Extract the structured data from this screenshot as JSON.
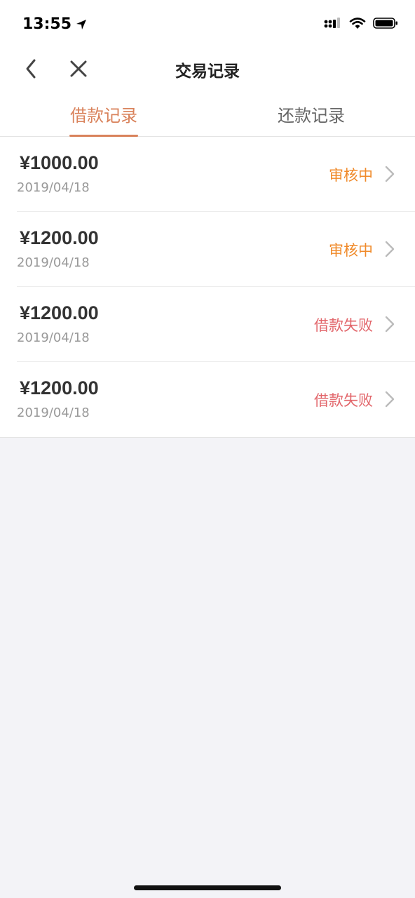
{
  "status_bar": {
    "time": "13:55",
    "icons": [
      "location-arrow-icon",
      "signal-icon",
      "wifi-icon",
      "battery-icon"
    ]
  },
  "nav": {
    "title": "交易记录",
    "back_icon": "chevron-left-icon",
    "close_icon": "close-icon"
  },
  "tabs": [
    {
      "label": "借款记录",
      "active": true
    },
    {
      "label": "还款记录",
      "active": false
    }
  ],
  "records": [
    {
      "amount": "¥1000.00",
      "date": "2019/04/18",
      "status": "审核中",
      "status_type": "pending"
    },
    {
      "amount": "¥1200.00",
      "date": "2019/04/18",
      "status": "审核中",
      "status_type": "pending"
    },
    {
      "amount": "¥1200.00",
      "date": "2019/04/18",
      "status": "借款失败",
      "status_type": "failed"
    },
    {
      "amount": "¥1200.00",
      "date": "2019/04/18",
      "status": "借款失败",
      "status_type": "failed"
    }
  ],
  "colors": {
    "accent": "#d9825b",
    "pending": "#f08a2a",
    "failed": "#e2656a",
    "background": "#f3f3f7"
  }
}
